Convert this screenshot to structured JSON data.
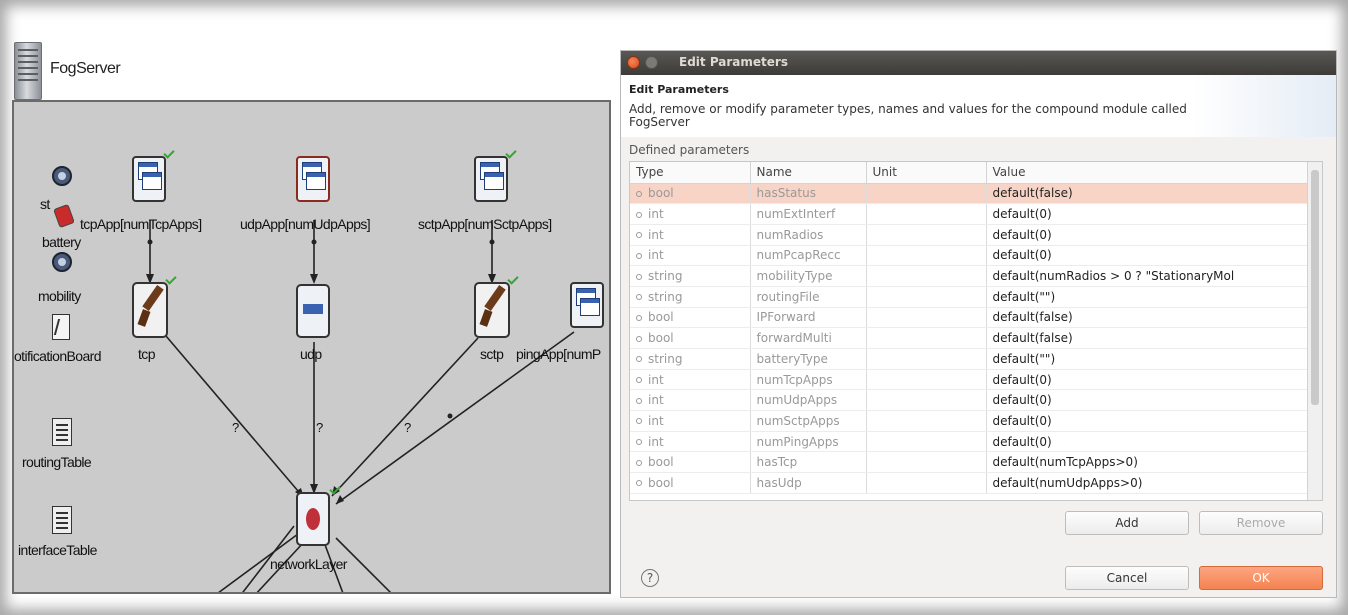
{
  "module": {
    "title": "FogServer",
    "submodules": {
      "tcp_app": "tcpApp[numTcpApps]",
      "udp_app": "udpApp[numUdpApps]",
      "sctp_app": "sctpApp[numSctpApps]",
      "ping_app": "pingApp[numP",
      "tcp": "tcp",
      "udp": "udp",
      "sctp": "sctp",
      "network_layer": "networkLayer",
      "status": "st",
      "battery": "battery",
      "mobility": "mobility",
      "notification_board": "otificationBoard",
      "routing_table": "routingTable",
      "interface_table": "interfaceTable"
    },
    "gate_marks": [
      "?",
      "?",
      "?"
    ]
  },
  "dialog": {
    "window_title": "Edit Parameters",
    "heading": "Edit Parameters",
    "description": "Add, remove or modify parameter types, names and values for the compound module called FogServer",
    "section_label": "Defined parameters",
    "columns": [
      "Type",
      "Name",
      "Unit",
      "Value"
    ],
    "rows": [
      {
        "type": "bool",
        "name": "hasStatus",
        "unit": "",
        "value": "default(false)",
        "selected": true
      },
      {
        "type": "int",
        "name": "numExtInterf",
        "unit": "",
        "value": "default(0)"
      },
      {
        "type": "int",
        "name": "numRadios",
        "unit": "",
        "value": "default(0)"
      },
      {
        "type": "int",
        "name": "numPcapRecc",
        "unit": "",
        "value": "default(0)"
      },
      {
        "type": "string",
        "name": "mobilityType",
        "unit": "",
        "value": "default(numRadios > 0 ? \"StationaryMol"
      },
      {
        "type": "string",
        "name": "routingFile",
        "unit": "",
        "value": "default(\"\")"
      },
      {
        "type": "bool",
        "name": "IPForward",
        "unit": "",
        "value": "default(false)"
      },
      {
        "type": "bool",
        "name": "forwardMulti",
        "unit": "",
        "value": "default(false)"
      },
      {
        "type": "string",
        "name": "batteryType",
        "unit": "",
        "value": "default(\"\")"
      },
      {
        "type": "int",
        "name": "numTcpApps",
        "unit": "",
        "value": "default(0)"
      },
      {
        "type": "int",
        "name": "numUdpApps",
        "unit": "",
        "value": "default(0)"
      },
      {
        "type": "int",
        "name": "numSctpApps",
        "unit": "",
        "value": "default(0)"
      },
      {
        "type": "int",
        "name": "numPingApps",
        "unit": "",
        "value": "default(0)"
      },
      {
        "type": "bool",
        "name": "hasTcp",
        "unit": "",
        "value": "default(numTcpApps>0)"
      },
      {
        "type": "bool",
        "name": "hasUdp",
        "unit": "",
        "value": "default(numUdpApps>0)"
      }
    ],
    "buttons": {
      "add": "Add",
      "remove": "Remove",
      "cancel": "Cancel",
      "ok": "OK",
      "help": "?"
    },
    "colors": {
      "selected_row": "#f8d4c6",
      "ok_button": "#f4834f",
      "titlebar": "#3c3b37"
    }
  }
}
